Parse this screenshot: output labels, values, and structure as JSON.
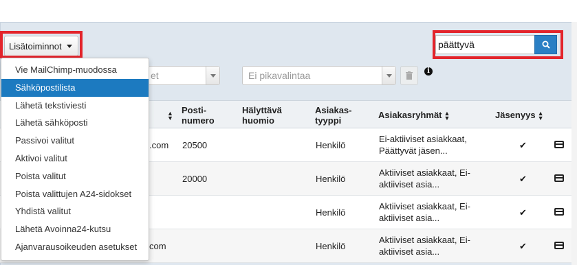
{
  "toolbar": {
    "actions_label": "Lisätoiminnot",
    "filter_placeholder": "Ei pikavalintaa",
    "search_value": "päättyvä"
  },
  "actions_menu": {
    "items": [
      {
        "label": "Vie MailChimp-muodossa",
        "active": false
      },
      {
        "label": "Sähköpostilista",
        "active": true
      },
      {
        "label": "Lähetä tekstiviesti",
        "active": false
      },
      {
        "label": "Lähetä sähköposti",
        "active": false
      },
      {
        "label": "Passivoi valitut",
        "active": false
      },
      {
        "label": "Aktivoi valitut",
        "active": false
      },
      {
        "label": "Poista valitut",
        "active": false
      },
      {
        "label": "Poista valittujen A24-sidokset",
        "active": false
      },
      {
        "label": "Yhdistä valitut",
        "active": false
      },
      {
        "label": "Lähetä Avoinna24-kutsu",
        "active": false
      },
      {
        "label": "Ajanvarausoikeuden asetukset",
        "active": false
      }
    ]
  },
  "table": {
    "headers": {
      "postal_line1": "Posti-",
      "postal_line2": "numero",
      "alert_line1": "Hälyttävä",
      "alert_line2": "huomio",
      "type_line1": "Asiakas-",
      "type_line2": "tyyppi",
      "groups": "Asiakasryhmät",
      "membership": "Jäsenyys"
    },
    "rows": [
      {
        "email_tail": ".com",
        "postal": "20500",
        "type": "Henkilö",
        "groups_line1": "Ei-aktiiviset asiakkaat,",
        "groups_line2": "Päättyvät jäsen..."
      },
      {
        "email_tail": "",
        "postal": "20000",
        "type": "Henkilö",
        "groups_line1": "Aktiiviset asiakkaat, Ei-",
        "groups_line2": "aktiiviset asia..."
      },
      {
        "email_tail": "",
        "postal": "",
        "type": "Henkilö",
        "groups_line1": "Aktiiviset asiakkaat, Ei-",
        "groups_line2": "aktiiviset asia..."
      },
      {
        "email_tail": "com",
        "postal": "",
        "type": "Henkilö",
        "groups_line1": "Aktiiviset asiakkaat, Ei-",
        "groups_line2": "aktiiviset asia..."
      }
    ]
  },
  "colors": {
    "highlight_border": "#e3242b",
    "accent": "#1c7ac0"
  }
}
